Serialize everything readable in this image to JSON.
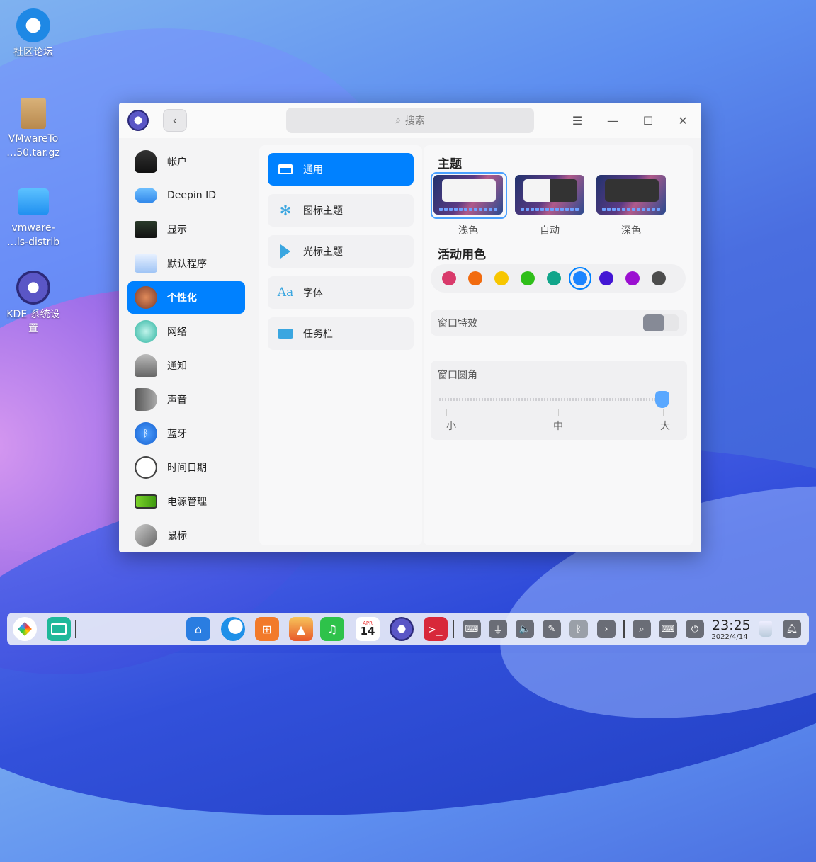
{
  "desktop": {
    "icons": [
      {
        "label": "社区论坛",
        "icon": "deepin-forum-icon"
      },
      {
        "label": "VMwareTo\n…50.tar.gz",
        "icon": "archive-icon"
      },
      {
        "label": "vmware-\n…ls-distrib",
        "icon": "folder-icon"
      },
      {
        "label": "KDE 系统设\n置",
        "icon": "kde-settings-icon"
      }
    ]
  },
  "window": {
    "search_placeholder": "搜索",
    "controls": {
      "menu": "☰",
      "minimize": "—",
      "maximize": "☐",
      "close": "✕"
    }
  },
  "sidebar": {
    "items": [
      {
        "label": "帐户",
        "icon": "account-icon",
        "color": "#222"
      },
      {
        "label": "Deepin ID",
        "icon": "cloud-icon",
        "color": "#3a8ef0"
      },
      {
        "label": "显示",
        "icon": "display-icon",
        "color": "#333"
      },
      {
        "label": "默认程序",
        "icon": "default-apps-icon",
        "color": "#4a90e2"
      },
      {
        "label": "个性化",
        "icon": "personalization-icon",
        "color": "#c0604a"
      },
      {
        "label": "网络",
        "icon": "network-icon",
        "color": "#2bb3a0"
      },
      {
        "label": "通知",
        "icon": "bell-icon",
        "color": "#888"
      },
      {
        "label": "声音",
        "icon": "speaker-icon",
        "color": "#666"
      },
      {
        "label": "蓝牙",
        "icon": "bluetooth-icon",
        "color": "#2f7bf0"
      },
      {
        "label": "时间日期",
        "icon": "clock-icon",
        "color": "#999"
      },
      {
        "label": "电源管理",
        "icon": "battery-icon",
        "color": "#6bbf2a"
      },
      {
        "label": "鼠标",
        "icon": "mouse-icon",
        "color": "#777"
      }
    ],
    "active_index": 4
  },
  "subnav": {
    "items": [
      {
        "label": "通用",
        "icon": "window-icon"
      },
      {
        "label": "图标主题",
        "icon": "flower-icon"
      },
      {
        "label": "光标主题",
        "icon": "cursor-icon"
      },
      {
        "label": "字体",
        "icon": "font-icon",
        "glyph": "Aa"
      },
      {
        "label": "任务栏",
        "icon": "taskbar-icon"
      }
    ],
    "active_index": 0
  },
  "content": {
    "theme_title": "主题",
    "themes": [
      {
        "label": "浅色",
        "selected": true
      },
      {
        "label": "自动",
        "selected": false
      },
      {
        "label": "深色",
        "selected": false
      }
    ],
    "accent_title": "活动用色",
    "accent_colors": [
      "#d93a6b",
      "#f26b0f",
      "#f7c600",
      "#2fbf1a",
      "#11a58a",
      "#1b84ff",
      "#4316d4",
      "#9b0fd1",
      "#4d4d4d"
    ],
    "accent_selected_index": 5,
    "window_effect_label": "窗口特效",
    "window_effect_enabled": false,
    "corner_label": "窗口圆角",
    "corner_marks": [
      "小",
      "中",
      "大"
    ],
    "corner_value": "大"
  },
  "taskbar": {
    "apps": [
      {
        "name": "launcher-icon",
        "color": "#ffffff"
      },
      {
        "name": "multitask-icon",
        "color": "#1fb89a"
      },
      {
        "name": "file-manager-icon",
        "color": "#2a7de1"
      },
      {
        "name": "browser-icon",
        "color": "#1e90e8"
      },
      {
        "name": "app-store-icon",
        "color": "#f27a2a"
      },
      {
        "name": "image-viewer-icon",
        "color": "#f0a030"
      },
      {
        "name": "music-icon",
        "color": "#2ec24a"
      },
      {
        "name": "calendar-icon",
        "color": "#ffffff"
      },
      {
        "name": "settings-icon",
        "color": "#5a56c6"
      },
      {
        "name": "terminal-icon",
        "color": "#d8283a"
      }
    ],
    "calendar_month": "APR",
    "calendar_day": "14",
    "tray": [
      "keyboard-icon",
      "usb-icon",
      "volume-icon",
      "pen-icon",
      "bluetooth-icon",
      "chevron-right-icon",
      "search-icon",
      "onboard-keyboard-icon",
      "power-icon"
    ],
    "time": "23:25",
    "date": "2022/4/14"
  }
}
